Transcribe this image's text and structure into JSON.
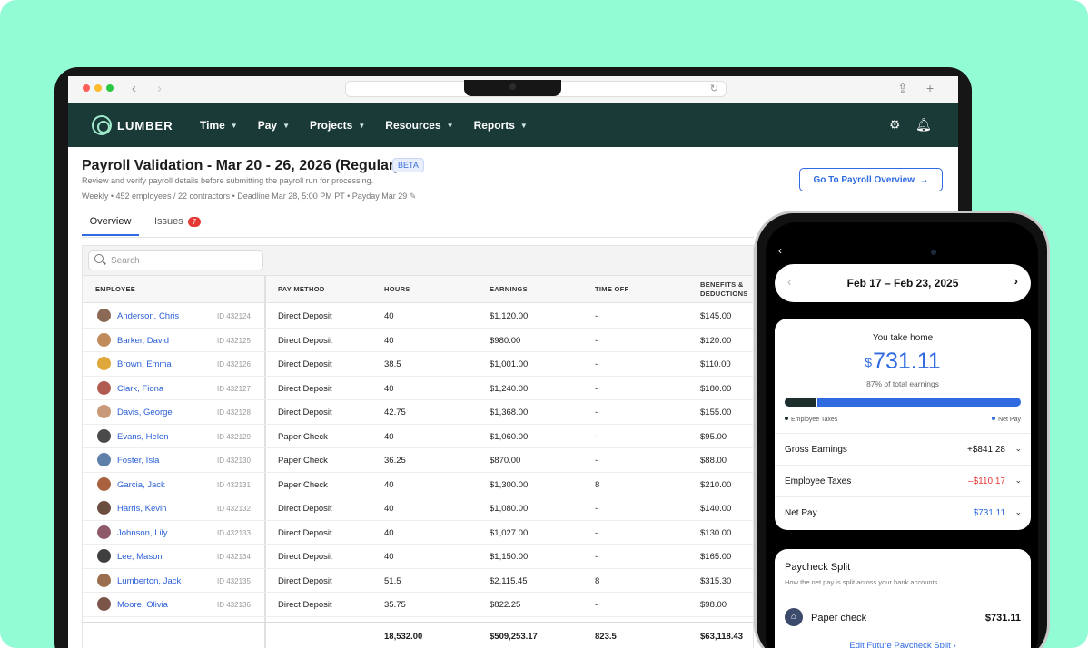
{
  "app": {
    "logo_text": "LUMBER",
    "menu": [
      {
        "label": "Time"
      },
      {
        "label": "Pay"
      },
      {
        "label": "Projects"
      },
      {
        "label": "Resources"
      },
      {
        "label": "Reports"
      }
    ],
    "icons": [
      "gear-icon",
      "bell-icon"
    ]
  },
  "header": {
    "title": "Payroll Validation - Mar 20 - 26, 2026 (Regular)",
    "badge": "BETA",
    "subtitle": "Review and verify payroll details before submitting the payroll run for processing.",
    "meta": "Weekly • 452 employees / 22 contractors • Deadline Mar 28, 5:00 PM PT • Payday Mar 29",
    "goto_button": "Go To Payroll Overview"
  },
  "tabs": {
    "overview": "Overview",
    "issues": "Issues",
    "issues_count": "7"
  },
  "search": {
    "placeholder": "Search"
  },
  "table": {
    "columns": {
      "employee": "EMPLOYEE",
      "pay_method": "PAY METHOD",
      "hours": "HOURS",
      "earnings": "EARNINGS",
      "time_off": "TIME OFF",
      "benefits": "BENEFITS &",
      "benefits2": "DEDUCTIONS"
    },
    "rows": [
      {
        "name": "Anderson, Chris",
        "id": "ID 432124",
        "method": "Direct Deposit",
        "hours": "40",
        "earnings": "$1,120.00",
        "timeoff": "-",
        "benefits": "$145.00",
        "avatar": "#8a6a55"
      },
      {
        "name": "Barker, David",
        "id": "ID 432125",
        "method": "Direct Deposit",
        "hours": "40",
        "earnings": "$980.00",
        "timeoff": "-",
        "benefits": "$120.00",
        "avatar": "#c08a5a"
      },
      {
        "name": "Brown, Emma",
        "id": "ID 432126",
        "method": "Direct Deposit",
        "hours": "38.5",
        "earnings": "$1,001.00",
        "timeoff": "-",
        "benefits": "$110.00",
        "avatar": "#e0a83a"
      },
      {
        "name": "Clark, Fiona",
        "id": "ID 432127",
        "method": "Direct Deposit",
        "hours": "40",
        "earnings": "$1,240.00",
        "timeoff": "-",
        "benefits": "$180.00",
        "avatar": "#b05b50"
      },
      {
        "name": "Davis, George",
        "id": "ID 432128",
        "method": "Direct Deposit",
        "hours": "42.75",
        "earnings": "$1,368.00",
        "timeoff": "-",
        "benefits": "$155.00",
        "avatar": "#c89a7a"
      },
      {
        "name": "Evans, Helen",
        "id": "ID 432129",
        "method": "Paper Check",
        "hours": "40",
        "earnings": "$1,060.00",
        "timeoff": "-",
        "benefits": "$95.00",
        "avatar": "#4a4a4a"
      },
      {
        "name": "Foster, Isla",
        "id": "ID 432130",
        "method": "Paper Check",
        "hours": "36.25",
        "earnings": "$870.00",
        "timeoff": "-",
        "benefits": "$88.00",
        "avatar": "#5d7fa8"
      },
      {
        "name": "Garcia, Jack",
        "id": "ID 432131",
        "method": "Paper Check",
        "hours": "40",
        "earnings": "$1,300.00",
        "timeoff": "8",
        "benefits": "$210.00",
        "avatar": "#a8623f"
      },
      {
        "name": "Harris, Kevin",
        "id": "ID 432132",
        "method": "Direct Deposit",
        "hours": "40",
        "earnings": "$1,080.00",
        "timeoff": "-",
        "benefits": "$140.00",
        "avatar": "#6b4e3d"
      },
      {
        "name": "Johnson, Lily",
        "id": "ID 432133",
        "method": "Direct Deposit",
        "hours": "40",
        "earnings": "$1,027.00",
        "timeoff": "-",
        "benefits": "$130.00",
        "avatar": "#8e5a6a"
      },
      {
        "name": "Lee, Mason",
        "id": "ID 432134",
        "method": "Direct Deposit",
        "hours": "40",
        "earnings": "$1,150.00",
        "timeoff": "-",
        "benefits": "$165.00",
        "avatar": "#3f3f3f"
      },
      {
        "name": "Lumberton, Jack",
        "id": "ID 432135",
        "method": "Direct Deposit",
        "hours": "51.5",
        "earnings": "$2,115.45",
        "timeoff": "8",
        "benefits": "$315.30",
        "avatar": "#9b6e4f"
      },
      {
        "name": "Moore, Olivia",
        "id": "ID 432136",
        "method": "Direct Deposit",
        "hours": "35.75",
        "earnings": "$822.25",
        "timeoff": "-",
        "benefits": "$98.00",
        "avatar": "#7a5548"
      }
    ],
    "totals": {
      "hours": "18,532.00",
      "earnings": "$509,253.17",
      "timeoff": "823.5",
      "benefits": "$63,118.43"
    }
  },
  "phone": {
    "date_range": "Feb 17 – Feb 23, 2025",
    "take_home_label": "You take home",
    "currency": "$",
    "take_home": "731.11",
    "pct_label": "87% of total earnings",
    "net_pay_fraction": 0.87,
    "legend_taxes": "Employee Taxes",
    "legend_net": "Net Pay",
    "summary": [
      {
        "label": "Gross Earnings",
        "value": "+$841.28",
        "color": "#111111"
      },
      {
        "label": "Employee Taxes",
        "value": "–$110.17",
        "color": "#e53935"
      },
      {
        "label": "Net Pay",
        "value": "$731.11",
        "color": "#2f6ae0"
      }
    ],
    "split_title": "Paycheck Split",
    "split_sub": "How the net pay is split across your bank accounts",
    "bank_name": "Paper check",
    "bank_amount": "$731.11",
    "edit_link": "Edit Future Paycheck Split"
  },
  "colors": {
    "background": "#92fcd4",
    "nav": "#1a3a38",
    "accent": "#2f6ae0",
    "negative": "#e53935"
  }
}
